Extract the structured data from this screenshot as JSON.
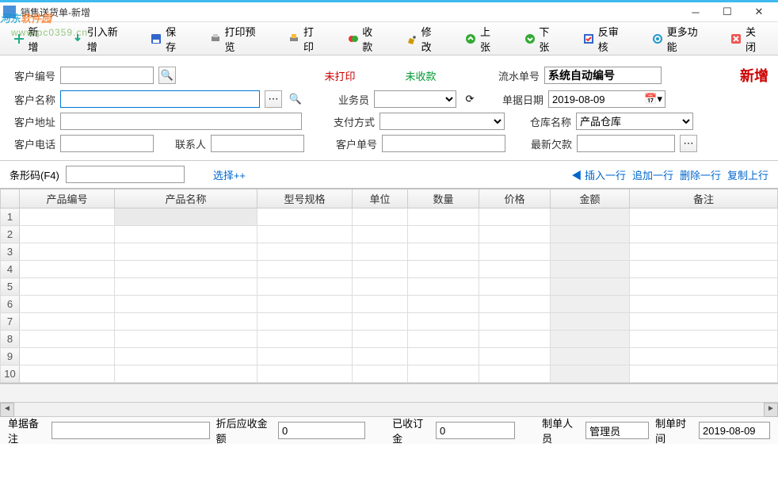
{
  "window": {
    "title": "销售送货单-新增"
  },
  "watermark": {
    "brand1": "河东",
    "brand2": "软件园",
    "url": "www.pc0359.cn"
  },
  "toolbar": {
    "new": "新增",
    "import": "引入新增",
    "save": "保存",
    "preview": "打印预览",
    "print": "打印",
    "receipt": "收款",
    "modify": "修改",
    "prev": "上张",
    "next": "下张",
    "unaudit": "反审核",
    "more": "更多功能",
    "close": "关闭"
  },
  "status": {
    "unprinted": "未打印",
    "unpaid": "未收款",
    "mode": "新增"
  },
  "fields": {
    "cust_no_lbl": "客户编号",
    "cust_no": "",
    "cust_name_lbl": "客户名称",
    "cust_name": "",
    "cust_addr_lbl": "客户地址",
    "cust_addr": "",
    "cust_tel_lbl": "客户电话",
    "cust_tel": "",
    "contact_lbl": "联系人",
    "contact": "",
    "serial_lbl": "流水单号",
    "serial": "系统自动编号",
    "date_lbl": "单据日期",
    "date": "2019-08-09",
    "sales_lbl": "业务员",
    "sales": "",
    "pay_lbl": "支付方式",
    "pay": "",
    "wh_lbl": "仓库名称",
    "wh": "产品仓库",
    "custorder_lbl": "客户单号",
    "custorder": "",
    "lastdebt_lbl": "最新欠款",
    "lastdebt": ""
  },
  "barcode": {
    "lbl": "条形码(F4)",
    "val": "",
    "select": "选择++"
  },
  "table_actions": {
    "insert": "◀ 插入一行",
    "append": "追加一行",
    "delete": "删除一行",
    "copy": "复制上行"
  },
  "columns": [
    "产品编号",
    "产品名称",
    "型号规格",
    "单位",
    "数量",
    "价格",
    "金额",
    "备注"
  ],
  "row_count": 10,
  "footer": {
    "remark_lbl": "单据备注",
    "remark": "",
    "discount_lbl": "折后应收金额",
    "discount": "0",
    "deposit_lbl": "已收订金",
    "deposit": "0",
    "maker_lbl": "制单人员",
    "maker": "管理员",
    "maketime_lbl": "制单时间",
    "maketime": "2019-08-09"
  }
}
